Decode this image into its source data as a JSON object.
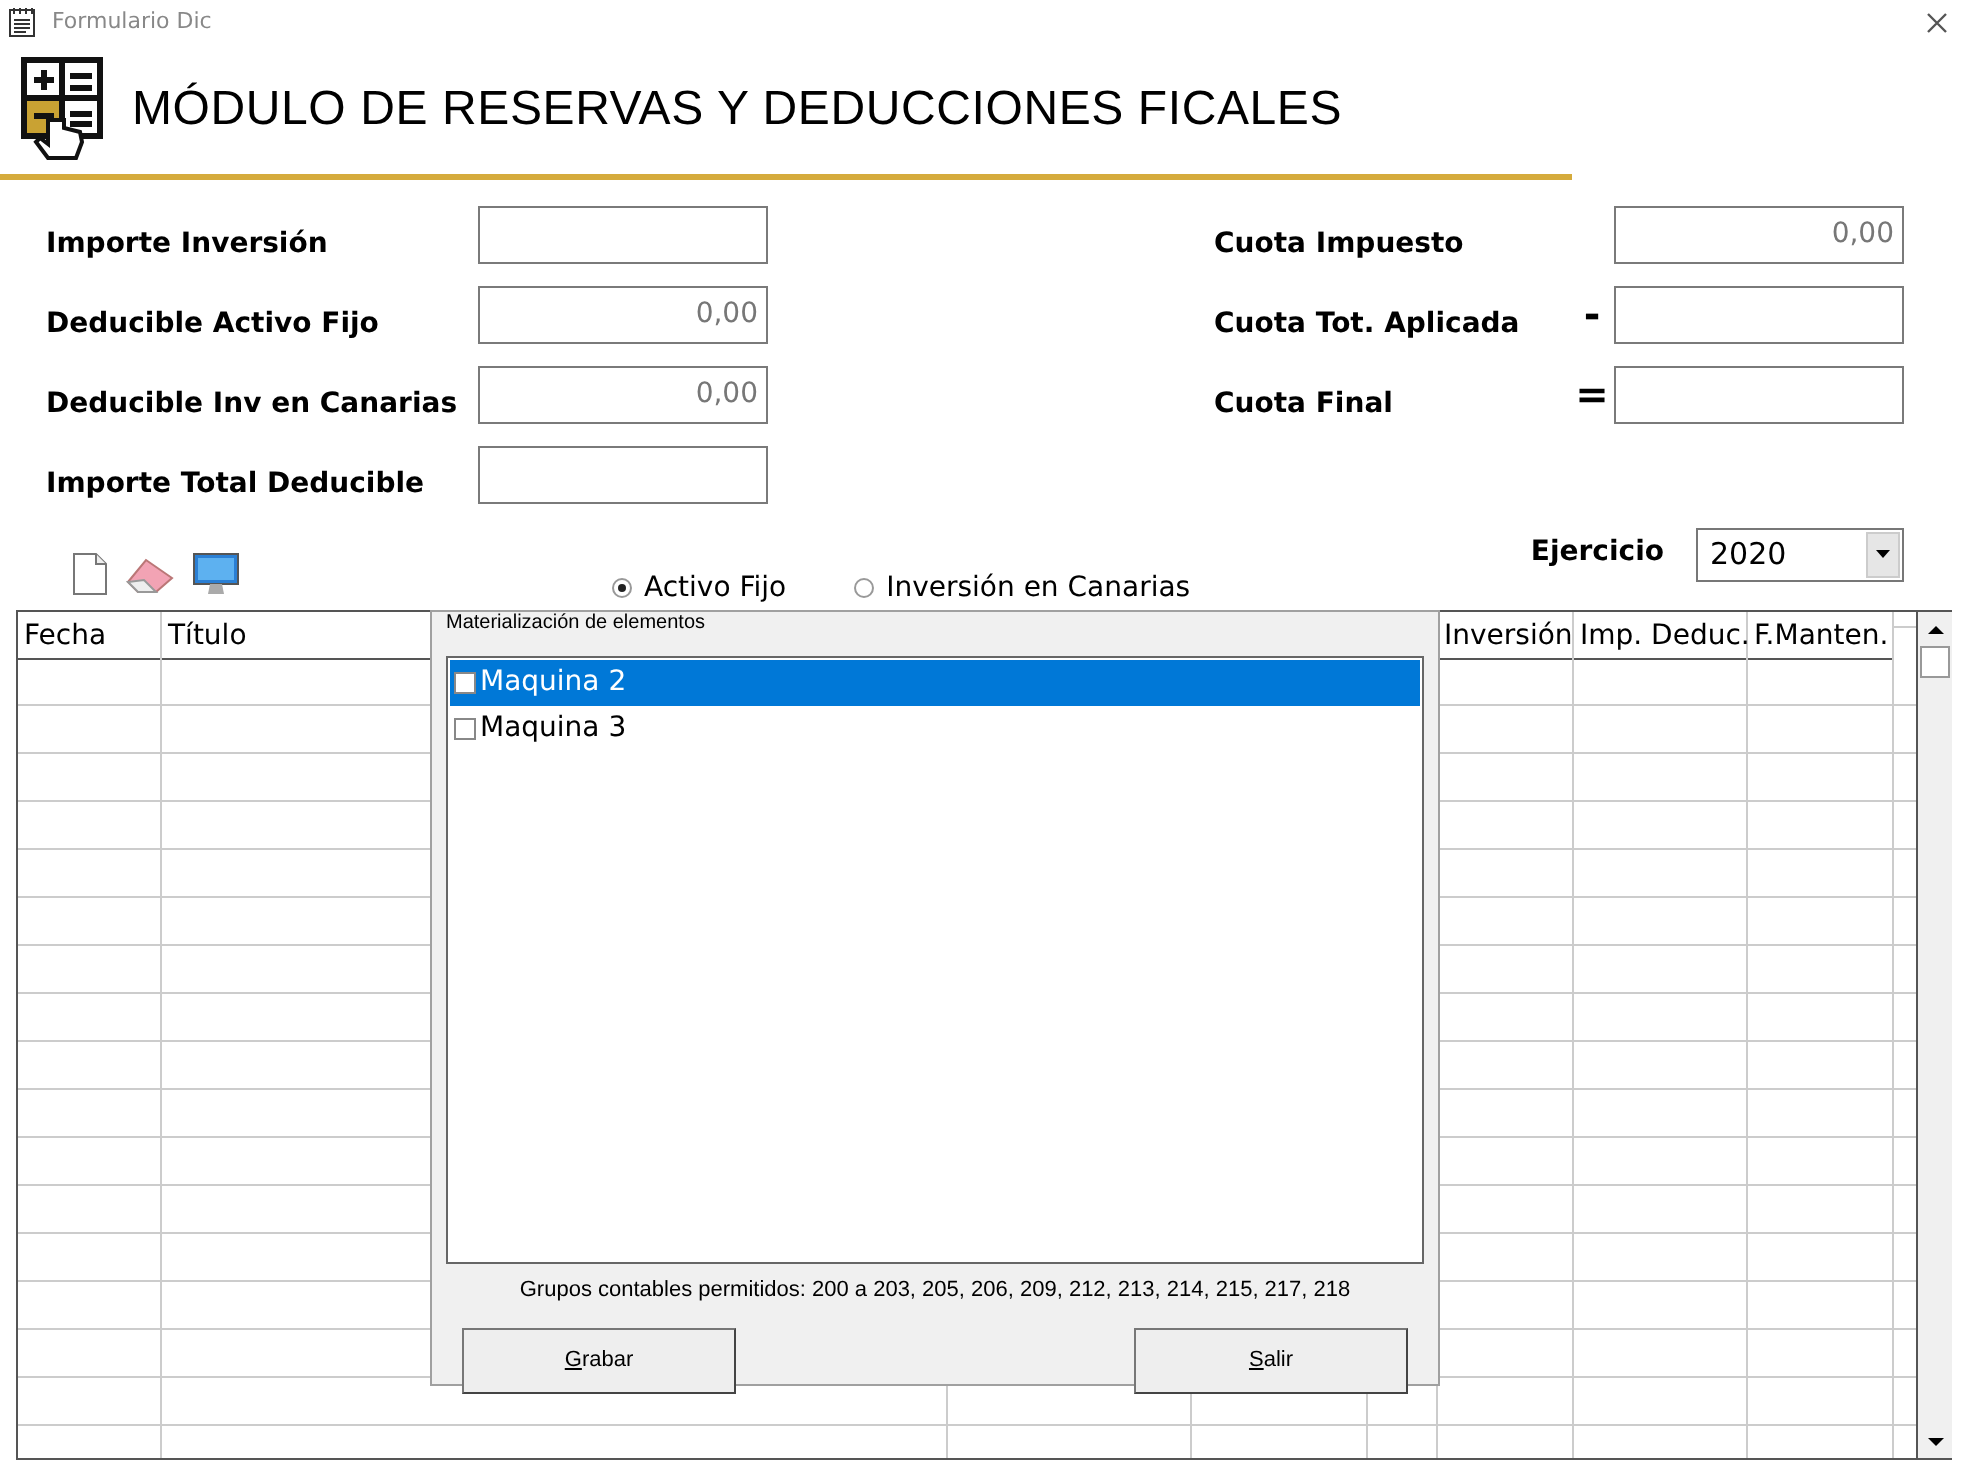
{
  "window": {
    "title": "Formulario Dic"
  },
  "header": {
    "title": "MÓDULO DE RESERVAS Y DEDUCCIONES FICALES"
  },
  "left_fields": [
    {
      "label": "Importe Inversión"
    },
    {
      "label": "Deducible Activo Fijo",
      "value": "0,00"
    },
    {
      "label": "Deducible Inv en Canarias",
      "value": "0,00"
    },
    {
      "label": "Importe Total Deducible"
    }
  ],
  "right_fields": [
    {
      "label": "Cuota Impuesto",
      "value": "0,00"
    },
    {
      "label": "Cuota Tot. Aplicada",
      "operator": "-"
    },
    {
      "label": "Cuota Final",
      "operator": "="
    }
  ],
  "radios": [
    {
      "label": "Activo Fijo",
      "selected": true
    },
    {
      "label": "Inversión en Canarias",
      "selected": false
    }
  ],
  "ejercicio": {
    "label": "Ejercicio",
    "value": "2020"
  },
  "table": {
    "columns_left": [
      "Fecha",
      "Título"
    ],
    "columns_right": [
      "Inversión",
      "Imp. Deduc.",
      "F.Manten."
    ]
  },
  "dialog": {
    "title": "Materialización de elementos",
    "items": [
      {
        "label": "Maquina 2",
        "checked": false,
        "selected": true
      },
      {
        "label": "Maquina 3",
        "checked": false,
        "selected": false
      }
    ],
    "note": "Grupos contables permitidos: 200 a 203, 205, 206, 209, 212, 213, 214, 215, 217, 218",
    "buttons": [
      "Grabar",
      "Salir"
    ]
  }
}
